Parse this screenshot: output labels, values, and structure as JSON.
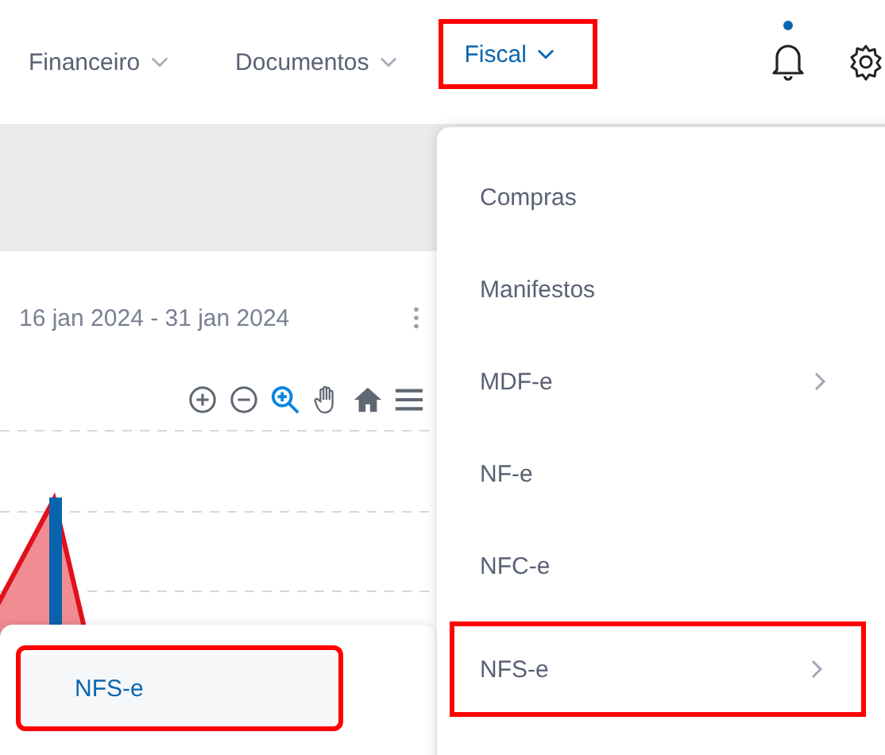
{
  "nav": [
    {
      "label": "Financeiro",
      "selected": false,
      "highlighted": false
    },
    {
      "label": "Documentos",
      "selected": false,
      "highlighted": false
    },
    {
      "label": "Fiscal",
      "selected": true,
      "highlighted": true
    }
  ],
  "notifications": {
    "unread": true
  },
  "card": {
    "date_range": "16 jan 2024 - 31 jan 2024",
    "chart_tools": [
      {
        "kind": "zoom-in",
        "selected": false
      },
      {
        "kind": "zoom-out",
        "selected": false
      },
      {
        "kind": "zoom",
        "selected": true
      },
      {
        "kind": "pan",
        "selected": false
      },
      {
        "kind": "home",
        "selected": false
      },
      {
        "kind": "menu",
        "selected": false
      }
    ]
  },
  "fiscal_menu": {
    "items": [
      {
        "label": "Compras",
        "has_submenu": false,
        "highlighted": false
      },
      {
        "label": "Manifestos",
        "has_submenu": false,
        "highlighted": false
      },
      {
        "label": "MDF-e",
        "has_submenu": true,
        "highlighted": false
      },
      {
        "label": "NF-e",
        "has_submenu": false,
        "highlighted": false
      },
      {
        "label": "NFC-e",
        "has_submenu": false,
        "highlighted": false
      },
      {
        "label": "NFS-e",
        "has_submenu": true,
        "highlighted": true
      }
    ]
  },
  "submenu": {
    "items": [
      {
        "label": "NFS-e",
        "selected": true,
        "highlighted": true
      }
    ]
  }
}
